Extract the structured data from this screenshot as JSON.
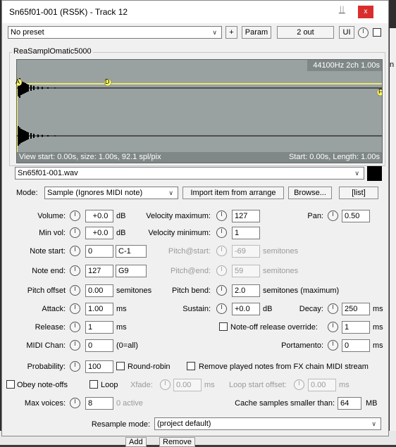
{
  "window": {
    "title": "Sn65f01-001 (RS5K) - Track 12",
    "close_label": "x"
  },
  "toolbar": {
    "preset": "No preset",
    "plus_label": "+",
    "param_label": "Param",
    "out_label": "2 out",
    "ui_label": "UI"
  },
  "plugin": {
    "name": "ReaSamplOmatic5000"
  },
  "waveform": {
    "info": "44100Hz 2ch 1.00s",
    "view_info": "View start: 0.00s, size: 1.00s, 92.1 spl/pix",
    "start_info": "Start: 0.00s, Length: 1.00s",
    "marker_a": "A",
    "marker_d": "D",
    "marker_f": "F"
  },
  "sample": {
    "file": "Sn65f01-001.wav"
  },
  "mode": {
    "label": "Mode:",
    "value": "Sample (Ignores MIDI note)",
    "import_label": "Import item from arrange",
    "browse_label": "Browse...",
    "list_label": "[list]"
  },
  "params": {
    "volume_label": "Volume:",
    "volume": "+0.0",
    "db1": "dB",
    "minvol_label": "Min vol:",
    "minvol": "+0.0",
    "db2": "dB",
    "notestart_label": "Note start:",
    "notestart": "0",
    "notestart_name": "C-1",
    "noteend_label": "Note end:",
    "noteend": "127",
    "noteend_name": "G9",
    "pitchoffset_label": "Pitch offset",
    "pitchoffset": "0.00",
    "semitones1": "semitones",
    "attack_label": "Attack:",
    "attack": "1.00",
    "ms1": "ms",
    "release_label": "Release:",
    "release": "1",
    "ms2": "ms",
    "midichan_label": "MIDI Chan:",
    "midichan": "0",
    "midichan_hint": "(0=all)",
    "probability_label": "Probability:",
    "probability": "100",
    "roundrobin_label": "Round-robin",
    "remove_notes_label": "Remove played notes from FX chain MIDI stream",
    "velmax_label": "Velocity maximum:",
    "velmax": "127",
    "velmin_label": "Velocity minimum:",
    "velmin": "1",
    "pitchstart_label": "Pitch@start:",
    "pitchstart": "-69",
    "semitones2": "semitones",
    "pitchend_label": "Pitch@end:",
    "pitchend": "59",
    "semitones3": "semitones",
    "pitchbend_label": "Pitch bend:",
    "pitchbend": "2.0",
    "semitones_max": "semitones (maximum)",
    "sustain_label": "Sustain:",
    "sustain": "+0.0",
    "db3": "dB",
    "decay_label": "Decay:",
    "decay": "250",
    "ms3": "ms",
    "pan_label": "Pan:",
    "pan": "0.50",
    "noteoff_override_label": "Note-off release override:",
    "noteoff_override": "1",
    "ms4": "ms",
    "portamento_label": "Portamento:",
    "portamento": "0",
    "ms5": "ms",
    "obey_label": "Obey note-offs",
    "loop_label": "Loop",
    "xfade_label": "Xfade:",
    "xfade": "0.00",
    "ms6": "ms",
    "loopstart_label": "Loop start offset:",
    "loopstart": "0.00",
    "ms7": "ms",
    "maxvoices_label": "Max voices:",
    "maxvoices": "8",
    "active": "0 active",
    "cache_label": "Cache samples smaller than:",
    "cache": "64",
    "mb": "MB",
    "resample_label": "Resample mode:",
    "resample": "(project default)"
  },
  "background": {
    "add_label": "Add",
    "remove_label": "Remove",
    "side_letter": "n"
  },
  "colors": {
    "waveform_bg": "#9aa1a1",
    "marker_yellow": "#ffff66",
    "close_red": "#d92d2d"
  }
}
